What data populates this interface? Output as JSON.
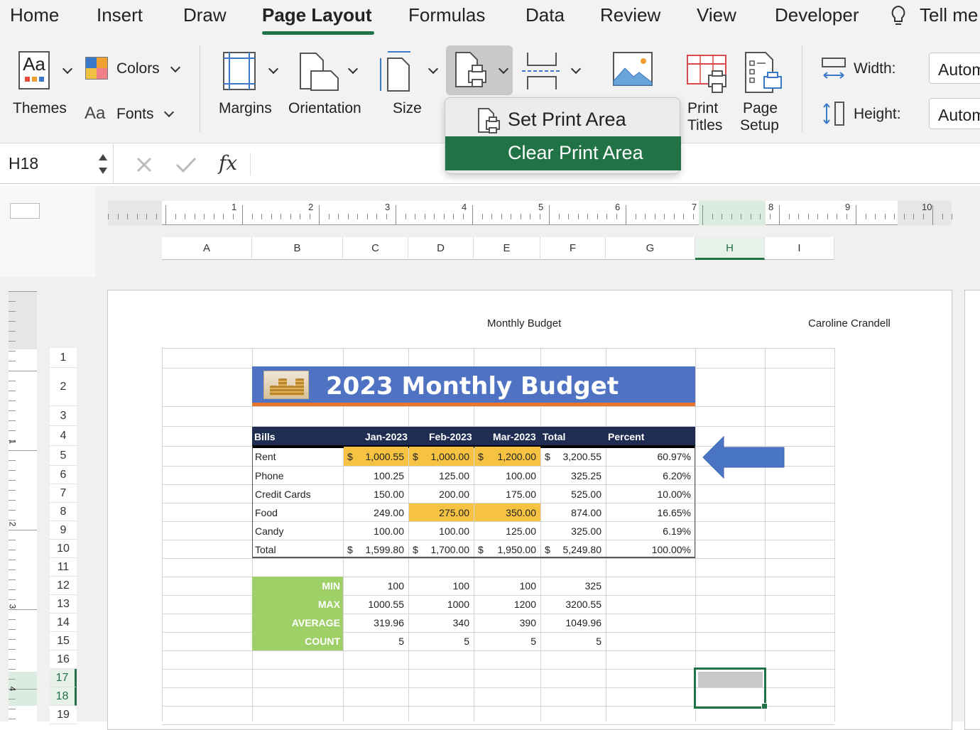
{
  "menu": {
    "tabs": [
      "Home",
      "Insert",
      "Draw",
      "Page Layout",
      "Formulas",
      "Data",
      "Review",
      "View",
      "Developer",
      "Tell me"
    ]
  },
  "ribbon": {
    "themes": "Themes",
    "colors": "Colors",
    "fonts": "Fonts",
    "fonts_glyph": "Aa",
    "themes_glyph": "Aa",
    "margins": "Margins",
    "orientation": "Orientation",
    "size": "Size",
    "print_titles": [
      "Print",
      "Titles"
    ],
    "page_setup": [
      "Page",
      "Setup"
    ],
    "width_label": "Width:",
    "height_label": "Height:",
    "width_value": "Automatic",
    "height_value": "Automatic"
  },
  "dropdown": {
    "set_print_area": "Set Print Area",
    "clear_print_area": "Clear Print Area"
  },
  "formula_bar": {
    "name_box": "H18",
    "fx": "fx",
    "formula": ""
  },
  "columns": [
    "A",
    "B",
    "C",
    "D",
    "E",
    "F",
    "G",
    "H",
    "I"
  ],
  "ruler_h": [
    "1",
    "2",
    "3",
    "4",
    "5",
    "6",
    "7",
    "8",
    "9",
    "10"
  ],
  "ruler_v": [
    "1",
    "2",
    "3",
    "4"
  ],
  "rows": [
    "1",
    "2",
    "3",
    "4",
    "5",
    "6",
    "7",
    "8",
    "9",
    "10",
    "11",
    "12",
    "13",
    "14",
    "15",
    "16",
    "17",
    "18",
    "19"
  ],
  "page_header": {
    "center": "Monthly Budget",
    "right": "Caroline Crandell"
  },
  "sheet": {
    "banner_title": "2023 Monthly Budget",
    "table_headers": [
      "Bills",
      "Jan-2023",
      "Feb-2023",
      "Mar-2023",
      "Total",
      "Percent"
    ],
    "table_rows": [
      {
        "label": "Rent",
        "jan": "1,000.55",
        "feb": "1,000.00",
        "mar": "1,200.00",
        "total": "3,200.55",
        "pct": "60.97%"
      },
      {
        "label": "Phone",
        "jan": "100.25",
        "feb": "125.00",
        "mar": "100.00",
        "total": "325.25",
        "pct": "6.20%"
      },
      {
        "label": "Credit Cards",
        "jan": "150.00",
        "feb": "200.00",
        "mar": "175.00",
        "total": "525.00",
        "pct": "10.00%"
      },
      {
        "label": "Food",
        "jan": "249.00",
        "feb": "275.00",
        "mar": "350.00",
        "total": "874.00",
        "pct": "16.65%"
      },
      {
        "label": "Candy",
        "jan": "100.00",
        "feb": "100.00",
        "mar": "125.00",
        "total": "325.00",
        "pct": "6.19%"
      },
      {
        "label": "Total",
        "jan": "1,599.80",
        "feb": "1,700.00",
        "mar": "1,950.00",
        "total": "5,249.80",
        "pct": "100.00%"
      }
    ],
    "currency": "$",
    "stats": [
      {
        "label": "MIN",
        "c": "100",
        "d": "100",
        "e": "100",
        "f": "325"
      },
      {
        "label": "MAX",
        "c": "1000.55",
        "d": "1000",
        "e": "1200",
        "f": "3200.55"
      },
      {
        "label": "AVERAGE",
        "c": "319.96",
        "d": "340",
        "e": "390",
        "f": "1049.96"
      },
      {
        "label": "COUNT",
        "c": "5",
        "d": "5",
        "e": "5",
        "f": "5"
      }
    ]
  },
  "colors": {
    "accent": "#217346",
    "banner": "#4f72c3",
    "banner_line": "#e8772e",
    "header_row": "#1f2d52",
    "highlight": "#f5c242",
    "stats_green": "#9fd067",
    "arrow": "#4a74c6"
  }
}
